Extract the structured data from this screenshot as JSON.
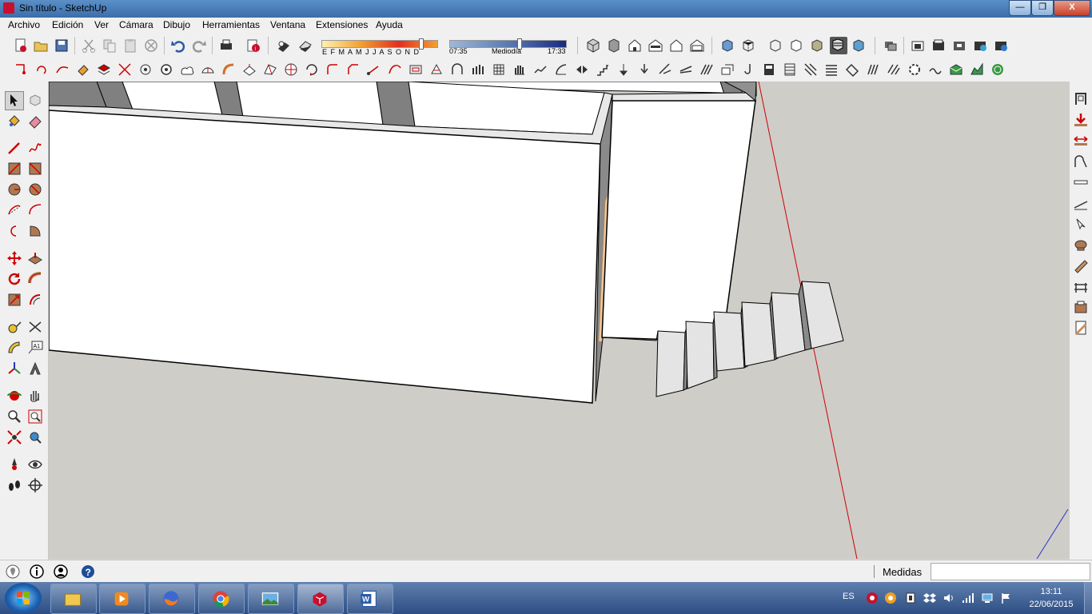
{
  "window": {
    "title": "Sin título - SketchUp",
    "min_label": "—",
    "max_label": "❐",
    "close_label": "X"
  },
  "menu": [
    "Archivo",
    "Edición",
    "Ver",
    "Cámara",
    "Dibujo",
    "Herramientas",
    "Ventana",
    "Extensiones",
    "Ayuda"
  ],
  "shadows": {
    "months": "E F M A M J J A S O N D",
    "time_start": "07:35",
    "time_mid": "Mediodía",
    "time_end": "17:33"
  },
  "status": {
    "measure_label": "Medidas",
    "measure_value": ""
  },
  "taskbar": {
    "lang": "ES",
    "time": "13:11",
    "date": "22/06/2015"
  },
  "colors": {
    "axis_red": "#cc0000",
    "axis_blue": "#2233cc",
    "ground": "#cfcdc8",
    "face": "#ffffff",
    "shade": "#808080",
    "edge": "#000000"
  }
}
